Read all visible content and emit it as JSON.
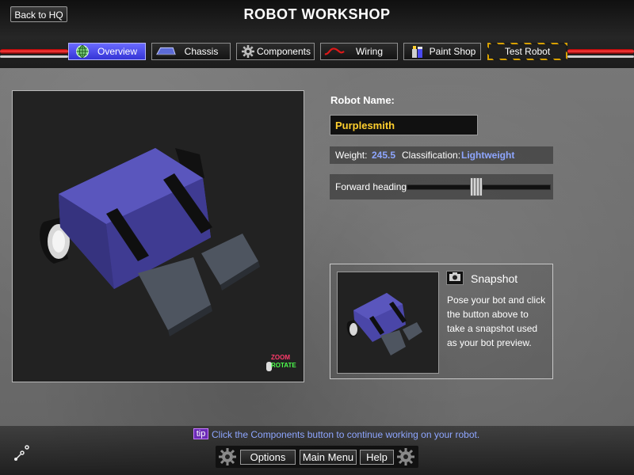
{
  "header": {
    "title": "ROBOT WORKSHOP",
    "back_label": "Back to HQ"
  },
  "tabs": [
    {
      "label": "Overview",
      "icon": "globe-icon",
      "active": true
    },
    {
      "label": "Chassis",
      "icon": "chassis-icon",
      "active": false
    },
    {
      "label": "Components",
      "icon": "gear-icon",
      "active": false
    },
    {
      "label": "Wiring",
      "icon": "wire-icon",
      "active": false
    },
    {
      "label": "Paint Shop",
      "icon": "paint-can-icon",
      "active": false
    },
    {
      "label": "Test Robot",
      "icon": "",
      "active": false
    }
  ],
  "viewport": {
    "hint_zoom": "ZOOM",
    "hint_rotate": "ROTATE"
  },
  "robot": {
    "name_label": "Robot Name:",
    "name_value": "Purplesmith",
    "weight_label": "Weight:",
    "weight_value": "245.5",
    "class_label": "Classification:",
    "class_value": "Lightweight",
    "heading_label": "Forward heading:",
    "heading_level": 0.49
  },
  "snapshot": {
    "title": "Snapshot",
    "description": "Pose your bot and click the button above to take a snapshot used as your bot preview."
  },
  "footer": {
    "tip_badge": "tip",
    "tip_text": "Click the Components button to continue working on your robot.",
    "options_label": "Options",
    "main_menu_label": "Main Menu",
    "help_label": "Help"
  },
  "colors": {
    "active_tab": "#4a4af0",
    "name_text": "#ffcf2e",
    "value_text": "#8ea6ff",
    "robot_body": "#4a46a8"
  }
}
